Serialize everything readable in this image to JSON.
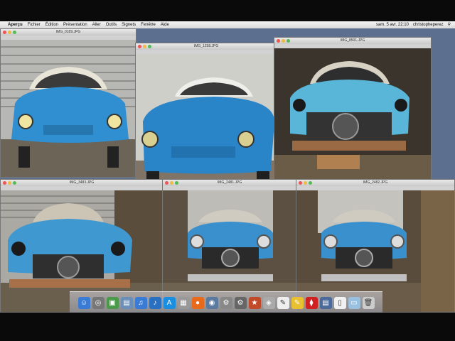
{
  "menubar": {
    "apple": "",
    "app": "Aperçu",
    "items": [
      "Fichier",
      "Édition",
      "Présentation",
      "Aller",
      "Outils",
      "Signets",
      "Fenêtre",
      "Aide"
    ],
    "clock": "sam. 5 avr. 22:10",
    "user": "christopheperez"
  },
  "windows": [
    {
      "title": "IMG_0189.JPG"
    },
    {
      "title": "IMG_1258.JPG"
    },
    {
      "title": "IMG_8501.JPG"
    },
    {
      "title": "IMG_3483.JPG"
    },
    {
      "title": "IMG_2481.JPG"
    },
    {
      "title": "IMG_2482.JPG"
    }
  ],
  "colors": {
    "car_blue": "#2f8fd0",
    "car_pale": "#5ab6d8",
    "garage_door": "#b9b9b5",
    "rust": "#8a5a3a"
  },
  "dock": {
    "icons": [
      "finder-icon",
      "launchpad-icon",
      "photos-icon",
      "preview-icon",
      "itunes-icon",
      "music-icon",
      "appstore-icon",
      "calculator-icon",
      "firefox-icon",
      "iphoto-icon",
      "settings-icon",
      "system-prefs-icon",
      "games-icon",
      "safari-icon",
      "textedit-icon",
      "notes-icon",
      "acrobat-icon",
      "preview2-icon",
      "document-icon",
      "folder-icon",
      "trash-icon"
    ]
  }
}
